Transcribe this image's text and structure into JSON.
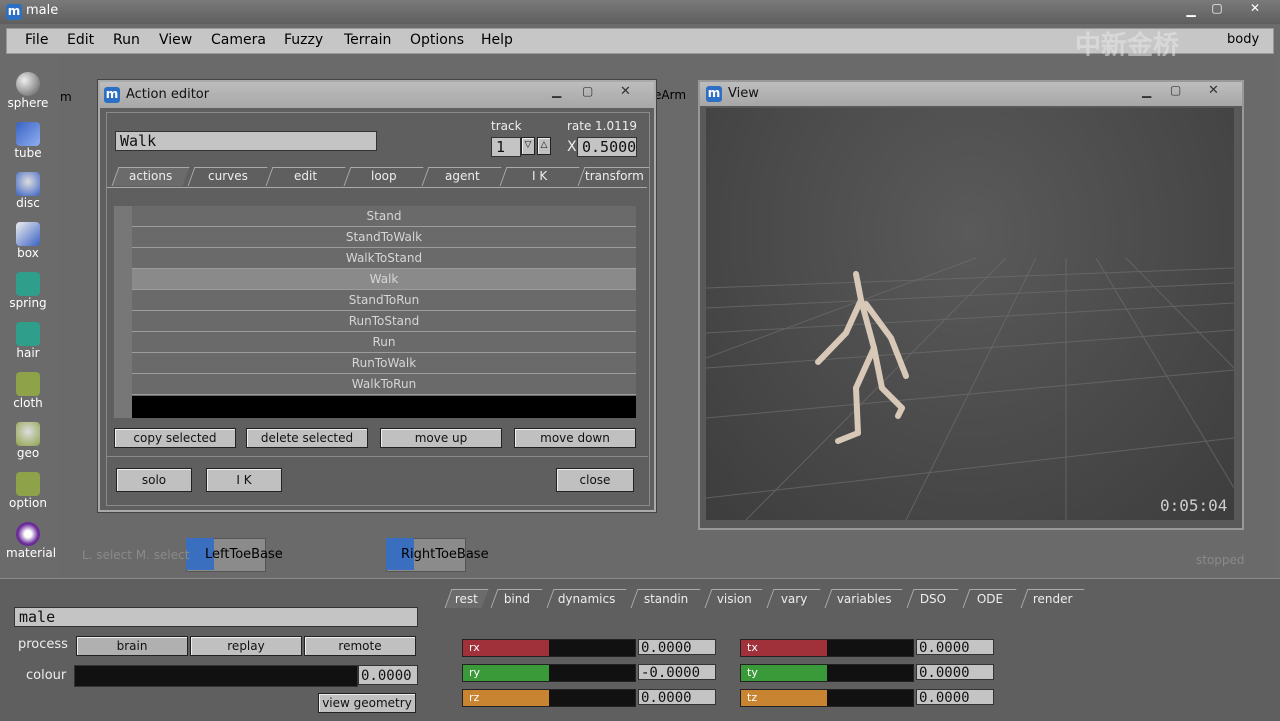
{
  "app": {
    "title": "male",
    "header_right": "body",
    "watermark": "中新金桥"
  },
  "menu": [
    "File",
    "Edit",
    "Run",
    "View",
    "Camera",
    "Fuzzy",
    "Terrain",
    "Options",
    "Help"
  ],
  "tools": [
    {
      "label": "sphere",
      "icon": "sphere-icon",
      "color": "#4a6cd4"
    },
    {
      "label": "tube",
      "icon": "tube-icon",
      "color": "#4a6cd4"
    },
    {
      "label": "disc",
      "icon": "disc-icon",
      "color": "#4a6cd4"
    },
    {
      "label": "box",
      "icon": "box-icon",
      "color": "#4a6cd4"
    },
    {
      "label": "spring",
      "icon": "spring-icon",
      "color": "#2f9e8a"
    },
    {
      "label": "hair",
      "icon": "hair-icon",
      "color": "#2f9e8a"
    },
    {
      "label": "cloth",
      "icon": "cloth-icon",
      "color": "#8ea24a"
    },
    {
      "label": "geo",
      "icon": "geo-icon",
      "color": "#8ea24a"
    },
    {
      "label": "option",
      "icon": "option-icon",
      "color": "#8ea24a"
    },
    {
      "label": "material",
      "icon": "material-icon",
      "color": "#6a2a9a"
    }
  ],
  "graph": {
    "nodes": [
      "LeftToeBase",
      "RightToeBase"
    ],
    "partial_left": "m",
    "partial_right": "eArm",
    "hint": "L. select M. select",
    "status": "stopped"
  },
  "action_editor": {
    "title": "Action editor",
    "name_value": "Walk",
    "track_label": "track",
    "track_value": "1",
    "rate_label": "rate",
    "rate_value": "1.0119",
    "x_label": "X",
    "x_value": "0.5000",
    "tabs": [
      "actions",
      "curves",
      "edit",
      "loop",
      "agent",
      "I K",
      "transform"
    ],
    "actions": [
      "Stand",
      "StandToWalk",
      "WalkToStand",
      "Walk",
      "StandToRun",
      "RunToStand",
      "Run",
      "RunToWalk",
      "WalkToRun"
    ],
    "selected_action": "Walk",
    "buttons": {
      "copy": "copy selected",
      "delete": "delete selected",
      "up": "move up",
      "down": "move down",
      "solo": "solo",
      "ik": "I K",
      "close": "close"
    }
  },
  "view": {
    "title": "View",
    "timecode": "0:05:04"
  },
  "bottom": {
    "name_value": "male",
    "process_label": "process",
    "process_buttons": [
      "brain",
      "replay",
      "remote"
    ],
    "colour_label": "colour",
    "colour_value": "0.0000",
    "view_geometry": "view geometry",
    "tabs": [
      "rest",
      "bind",
      "dynamics",
      "standin",
      "vision",
      "vary",
      "variables",
      "DSO",
      "ODE",
      "render"
    ],
    "params": [
      {
        "label": "rx",
        "value": "0.0000",
        "color": "#a0303a"
      },
      {
        "label": "ry",
        "value": "-0.0000",
        "color": "#3a9a3a"
      },
      {
        "label": "rz",
        "value": "0.0000",
        "color": "#c88430"
      },
      {
        "label": "tx",
        "value": "0.0000",
        "color": "#a0303a"
      },
      {
        "label": "ty",
        "value": "0.0000",
        "color": "#3a9a3a"
      },
      {
        "label": "tz",
        "value": "0.0000",
        "color": "#c88430"
      }
    ]
  }
}
